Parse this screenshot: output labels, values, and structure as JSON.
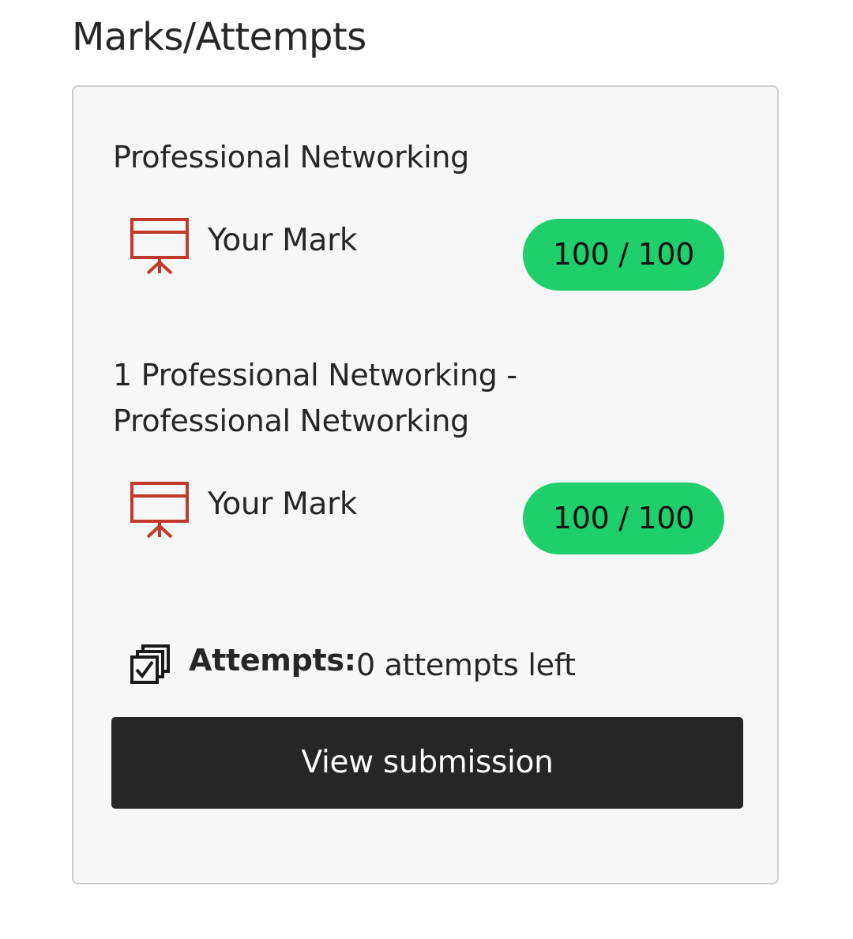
{
  "page": {
    "title": "Marks/Attempts"
  },
  "sections": [
    {
      "title": "Professional Networking",
      "mark_label": "Your Mark",
      "mark_value": "100 / 100",
      "score": 100,
      "max_score": 100,
      "icon": "presentation-board-icon"
    },
    {
      "title_line_1": "1 Professional Networking -",
      "title_line_2": "Professional Networking",
      "mark_label": "Your Mark",
      "mark_value": "100 / 100",
      "score": 100,
      "max_score": 100,
      "icon": "presentation-board-icon"
    }
  ],
  "attempts": {
    "label": "Attempts:",
    "value": "0 attempts left",
    "icon": "stacked-checkbox-icon"
  },
  "actions": {
    "view_submission_label": "View submission"
  },
  "colors": {
    "icon_red": "#c0392b",
    "badge_green": "#1fcf6b",
    "button_dark": "#262626",
    "panel_background": "#f7f7f7"
  }
}
